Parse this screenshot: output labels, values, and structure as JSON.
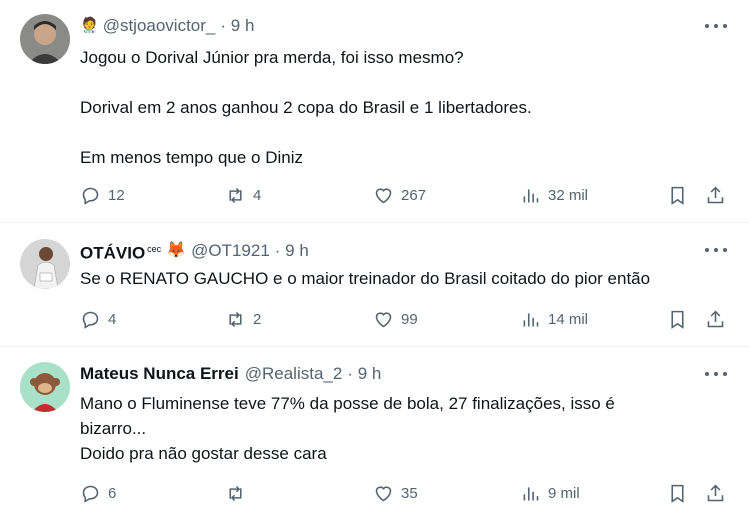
{
  "tweets": [
    {
      "name": "",
      "badge": "🧑‍⚕️",
      "handle": "@stjoaovictor_",
      "time": "· 9 h",
      "lines": [
        "Jogou o Dorival Júnior pra merda, foi isso mesmo?",
        "",
        "Dorival em 2 anos ganhou 2 copa do Brasil e 1 libertadores.",
        "",
        "Em menos tempo que o Diniz"
      ],
      "replies": "12",
      "reposts": "4",
      "likes": "267",
      "views": "32 mil"
    },
    {
      "name": "OTÁVIO",
      "name_sup": "cec",
      "badge": "🦊",
      "handle": "@OT1921",
      "time": "· 9 h",
      "lines": [
        "Se o RENATO GAUCHO e o maior treinador do Brasil coitado do pior então"
      ],
      "replies": "4",
      "reposts": "2",
      "likes": "99",
      "views": "14 mil"
    },
    {
      "name": "Mateus Nunca Errei",
      "badge": "",
      "handle": "@Realista_2",
      "time": "· 9 h",
      "lines": [
        "Mano o Fluminense teve 77% da posse de bola, 27 finalizações, isso é",
        "bizarro...",
        "Doido pra não gostar desse cara"
      ],
      "replies": "6",
      "reposts": "",
      "likes": "35",
      "views": "9 mil"
    }
  ],
  "colors": {
    "text": "#0f1419",
    "secondary": "#536471",
    "divider": "#eff3f4"
  },
  "icons": [
    "more-icon",
    "reply-icon",
    "repost-icon",
    "like-icon",
    "views-icon",
    "bookmark-icon",
    "share-icon"
  ]
}
